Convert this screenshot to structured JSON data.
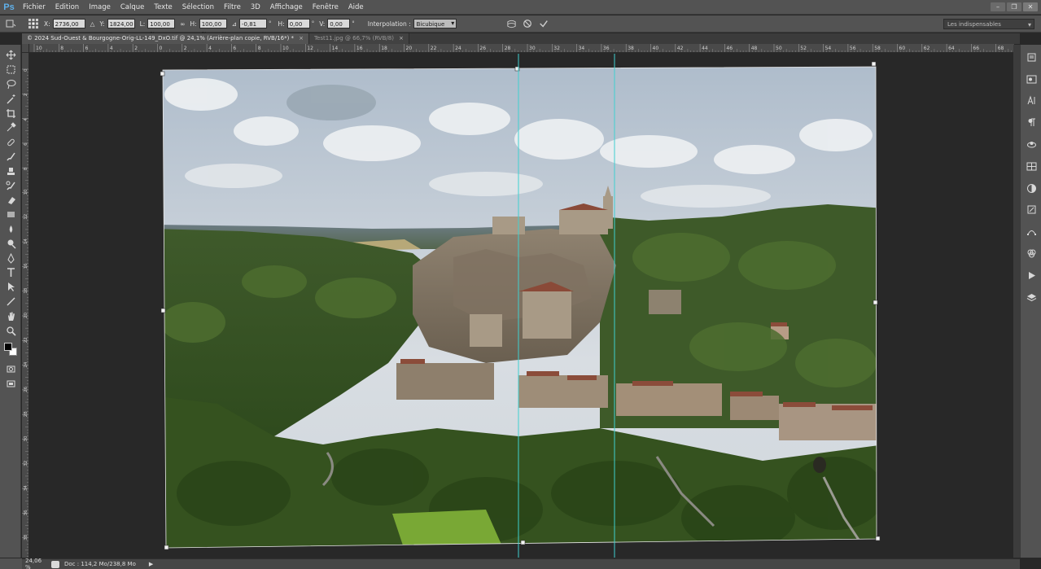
{
  "app": {
    "logo": "Ps"
  },
  "menu": [
    "Fichier",
    "Edition",
    "Image",
    "Calque",
    "Texte",
    "Sélection",
    "Filtre",
    "3D",
    "Affichage",
    "Fenêtre",
    "Aide"
  ],
  "window_controls": {
    "minimize": "–",
    "maximize": "❐",
    "close": "✕"
  },
  "options": {
    "x_label": "X:",
    "x_value": "2736,00 p",
    "y_label": "Y:",
    "y_value": "1824,00 p",
    "w_label": "L:",
    "w_value": "100,00 %",
    "h_label": "H:",
    "h_value": "100,00 %",
    "angle_value": "-0,81",
    "angle_unit": "°",
    "hskew_label": "H:",
    "hskew_value": "0,00",
    "vskew_label": "V:",
    "vskew_value": "0,00",
    "skew_unit": "°",
    "interpolation_label": "Interpolation :",
    "interpolation_value": "Bicubique",
    "workspace": "Les indispensables"
  },
  "tabs": [
    {
      "label": "© 2024 Sud-Ouest & Bourgogne-Orig-LL-149_DxO.tif @ 24,1% (Arrière-plan copie, RVB/16*) *",
      "close": "×",
      "active": true
    },
    {
      "label": "Test11.jpg @ 66,7% (RVB/8)",
      "close": "×",
      "active": false
    }
  ],
  "ruler_h_labels": [
    "10",
    "8",
    "6",
    "4",
    "2",
    "0",
    "2",
    "4",
    "6",
    "8",
    "10",
    "12",
    "14",
    "16",
    "18",
    "20",
    "22",
    "24",
    "26",
    "28",
    "30",
    "32",
    "34",
    "36",
    "38",
    "40",
    "42",
    "44",
    "46",
    "48",
    "50",
    "52",
    "54",
    "56",
    "58",
    "60",
    "62",
    "64",
    "66",
    "68"
  ],
  "ruler_v_labels": [
    "0",
    "2",
    "4",
    "6",
    "8",
    "10",
    "12",
    "14",
    "16",
    "18",
    "20",
    "22",
    "24",
    "26",
    "28",
    "30",
    "32",
    "34",
    "36",
    "38"
  ],
  "tools": [
    "move-tool",
    "marquee-tool",
    "lasso-tool",
    "magic-wand-tool",
    "crop-tool",
    "eyedropper-tool",
    "healing-brush-tool",
    "brush-tool",
    "clone-stamp-tool",
    "history-brush-tool",
    "eraser-tool",
    "gradient-tool",
    "blur-tool",
    "dodge-tool",
    "pen-tool",
    "type-tool",
    "path-selection-tool",
    "line-tool",
    "hand-tool",
    "zoom-tool"
  ],
  "right_panel_icons": [
    "history-icon",
    "color-icon",
    "character-icon",
    "paragraph-icon",
    "swatches-icon",
    "layers-comp-icon",
    "adjustments-icon",
    "properties-icon",
    "paths-icon",
    "channels-icon",
    "actions-icon",
    "layers-icon"
  ],
  "colors": {
    "accent": "#5fb0ea",
    "guide": "#3fd0d0",
    "background": "#282828",
    "panel": "#535353"
  },
  "status": {
    "zoom": "24,06 %",
    "doc": "Doc : 114,2 Mo/238,8 Mo",
    "arrow": "▶"
  }
}
